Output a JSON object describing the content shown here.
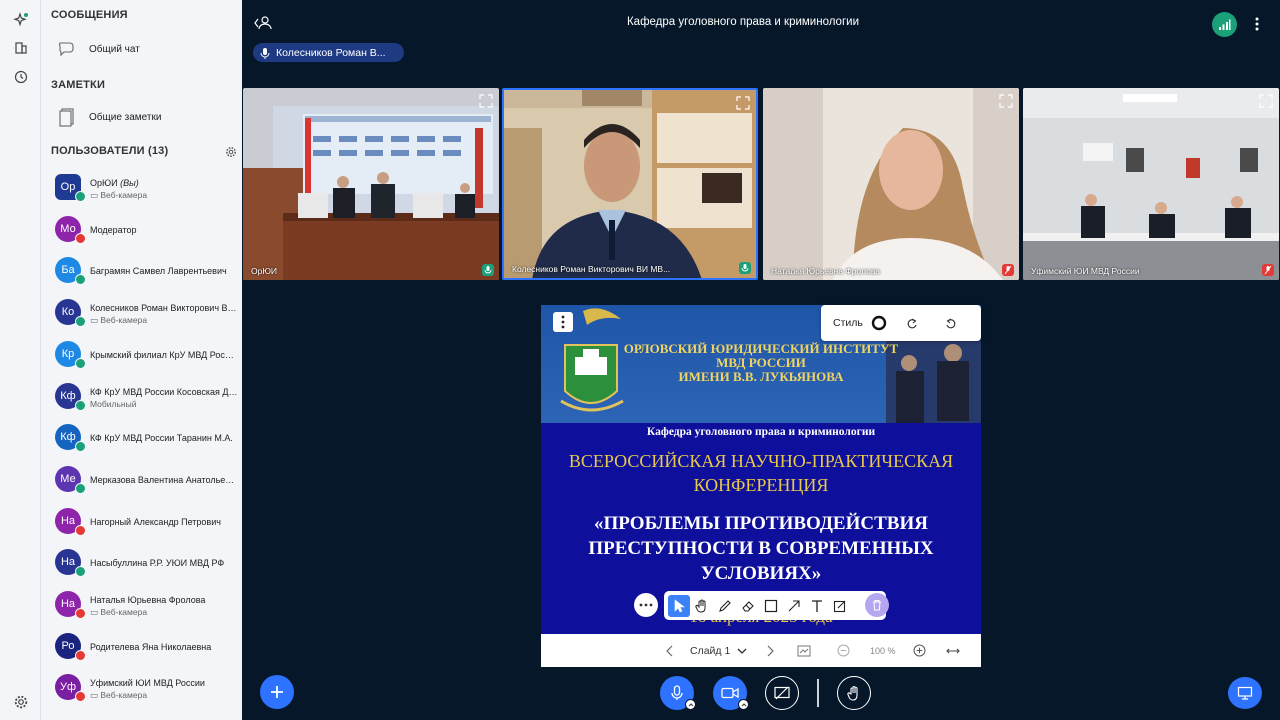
{
  "rail": {
    "items": [
      "ai-sparkle-icon",
      "layout-icon",
      "history-icon",
      "settings-icon"
    ]
  },
  "panel": {
    "messages_title": "СООБЩЕНИЯ",
    "general_chat": "Общий чат",
    "notes_title": "ЗАМЕТКИ",
    "shared_notes": "Общие заметки",
    "users_title": "ПОЛЬЗОВАТЕЛИ (13)",
    "users": [
      {
        "initials": "Ор",
        "name": "ОрЮИ (Вы)",
        "sub": "▭ Веб-камера",
        "color": "#1f3a93",
        "badge": "#1aa179"
      },
      {
        "initials": "Мо",
        "name": "Модератор",
        "sub": "",
        "color": "#8e24aa",
        "badge": "#e53935"
      },
      {
        "initials": "Ба",
        "name": "Баграмян Самвел Лаврентьевич",
        "sub": "",
        "color": "#1e88e5",
        "badge": "#1aa179"
      },
      {
        "initials": "Ко",
        "name": "Колесников Роман Викторович ВИ МВД России",
        "sub": "▭ Веб-камера",
        "color": "#283593",
        "badge": "#1aa179"
      },
      {
        "initials": "Кр",
        "name": "Крымский филиал КрУ МВД России",
        "sub": "",
        "color": "#1e88e5",
        "badge": "#1aa179"
      },
      {
        "initials": "Кф",
        "name": "КФ КрУ МВД России Косовская Д.В.",
        "sub": "Мобильный",
        "color": "#283593",
        "badge": "#1aa179"
      },
      {
        "initials": "Кф",
        "name": "КФ КрУ МВД России Таранин М.А.",
        "sub": "",
        "color": "#1565c0",
        "badge": "#1aa179"
      },
      {
        "initials": "Ме",
        "name": "Мерказова Валентина Анатольевна",
        "sub": "",
        "color": "#5e35b1",
        "badge": "#1aa179"
      },
      {
        "initials": "На",
        "name": "Нагорный Александр Петрович",
        "sub": "",
        "color": "#8e24aa",
        "badge": "#e53935"
      },
      {
        "initials": "На",
        "name": "Насыбуллина Р.Р. УЮИ МВД РФ",
        "sub": "",
        "color": "#283593",
        "badge": "#1aa179"
      },
      {
        "initials": "На",
        "name": "Наталья Юрьевна Фролова",
        "sub": "▭ Веб-камера",
        "color": "#8e24aa",
        "badge": "#e53935"
      },
      {
        "initials": "Ро",
        "name": "Родителева Яна Николаевна",
        "sub": "",
        "color": "#1a237e",
        "badge": "#e53935"
      },
      {
        "initials": "Уф",
        "name": "Уфимский ЮИ МВД России",
        "sub": "▭ Веб-камера",
        "color": "#7b1fa2",
        "badge": "#e53935"
      }
    ]
  },
  "header": {
    "title": "Кафедра уголовного права и криминологии",
    "speaker": "Колесников Роман В..."
  },
  "tiles": [
    {
      "name": "ОрЮИ",
      "mic": "on"
    },
    {
      "name": "Колесников Роман Викторович ВИ МВ...",
      "mic": "on"
    },
    {
      "name": "Наталья Юрьевна Фролова",
      "mic": "off"
    },
    {
      "name": "Уфимский ЮИ МВД России",
      "mic": "off"
    }
  ],
  "whiteboard": {
    "style_label": "Стиль",
    "slide": {
      "institute_line1": "ОРЛОВСКИЙ ЮРИДИЧЕСКИЙ ИНСТИТУТ",
      "institute_line2": "МВД РОССИИ",
      "institute_line3": "ИМЕНИ В.В. ЛУКЬЯНОВА",
      "department": "Кафедра уголовного права и криминологии",
      "conf_line1": "ВСЕРОССИЙСКАЯ НАУЧНО-ПРАКТИЧЕСКАЯ",
      "conf_line2": "КОНФЕРЕНЦИЯ",
      "topic_line1": "«ПРОБЛЕМЫ ПРОТИВОДЕЙСТВИЯ",
      "topic_line2": "ПРЕСТУПНОСТИ В СОВРЕМЕННЫХ",
      "topic_line3": "УСЛОВИЯХ»",
      "date": "18 апреля 2025 года"
    },
    "slide_label": "Слайд 1",
    "zoom": "100 %"
  },
  "colors": {
    "accent": "#2d73ff",
    "bg": "#06172a",
    "slide": "#0e0f9a",
    "gold": "#e8c84a"
  }
}
